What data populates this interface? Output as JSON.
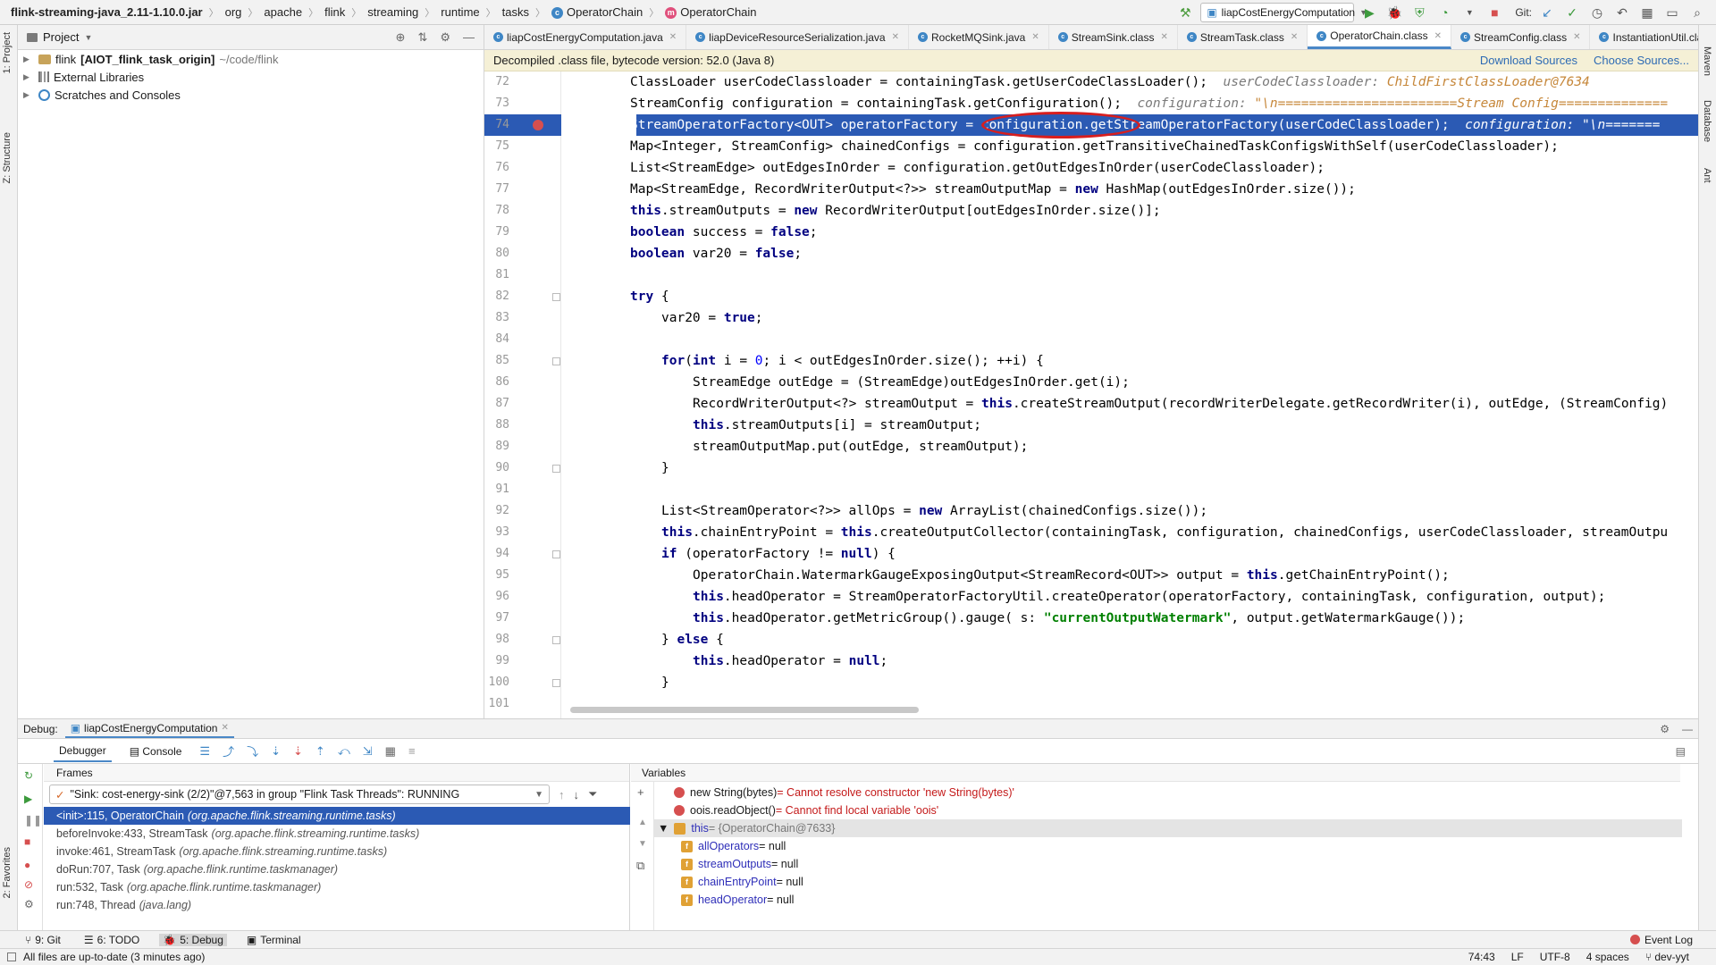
{
  "breadcrumbs": [
    "flink-streaming-java_2.11-1.10.0.jar",
    "org",
    "apache",
    "flink",
    "streaming",
    "runtime",
    "tasks",
    "OperatorChain",
    "OperatorChain"
  ],
  "run_config": "liapCostEnergyComputation",
  "git_label": "Git:",
  "left_strip": {
    "project": "1: Project",
    "structure": "Z: Structure",
    "favorites": "2: Favorites"
  },
  "right_strip": {
    "maven": "Maven",
    "database": "Database",
    "ant": "Ant"
  },
  "project_panel": {
    "title": "Project",
    "tree": [
      {
        "label": "flink",
        "bold_suffix": "[AIOT_flink_task_origin]",
        "path": "~/code/flink"
      },
      {
        "label": "External Libraries"
      },
      {
        "label": "Scratches and Consoles"
      }
    ]
  },
  "editor_tabs": [
    {
      "label": "liapCostEnergyComputation.java",
      "active": false
    },
    {
      "label": "liapDeviceResourceSerialization.java",
      "active": false
    },
    {
      "label": "RocketMQSink.java",
      "active": false
    },
    {
      "label": "StreamSink.class",
      "active": false
    },
    {
      "label": "StreamTask.class",
      "active": false
    },
    {
      "label": "OperatorChain.class",
      "active": true
    },
    {
      "label": "StreamConfig.class",
      "active": false
    },
    {
      "label": "InstantiationUtil.class",
      "active": false
    }
  ],
  "notice": {
    "text": "Decompiled .class file, bytecode version: 52.0 (Java 8)",
    "download_sources": "Download Sources",
    "choose_sources": "Choose Sources..."
  },
  "code_lines": [
    {
      "n": "72",
      "indent": 0,
      "text": "ClassLoader userCodeClassloader = containingTask.getUserCodeClassLoader();",
      "hint": "userCodeClassloader:",
      "hintval": "ChildFirstClassLoader@7634"
    },
    {
      "n": "73",
      "indent": 0,
      "text": "StreamConfig configuration = containingTask.getConfiguration();",
      "hint": "configuration:",
      "hintval": "\"\\n=======================Stream Config=============="
    },
    {
      "n": "74",
      "indent": 0,
      "text": "StreamOperatorFactory<OUT> operatorFactory = configuration.getStreamOperatorFactory(userCodeClassloader);",
      "hint": "configuration:",
      "hintval": "\"\\n=======",
      "selected": true,
      "breakpoint": true
    },
    {
      "n": "75",
      "indent": 0,
      "text": "Map<Integer, StreamConfig> chainedConfigs = configuration.getTransitiveChainedTaskConfigsWithSelf(userCodeClassloader);"
    },
    {
      "n": "76",
      "indent": 0,
      "text": "List<StreamEdge> outEdgesInOrder = configuration.getOutEdgesInOrder(userCodeClassloader);"
    },
    {
      "n": "77",
      "indent": 0,
      "text": "Map<StreamEdge, RecordWriterOutput<?>> streamOutputMap = new HashMap(outEdgesInOrder.size());"
    },
    {
      "n": "78",
      "indent": 0,
      "text": "this.streamOutputs = new RecordWriterOutput[outEdgesInOrder.size()];"
    },
    {
      "n": "79",
      "indent": 0,
      "text": "boolean success = false;"
    },
    {
      "n": "80",
      "indent": 0,
      "text": "boolean var20 = false;"
    },
    {
      "n": "81",
      "indent": 0,
      "text": ""
    },
    {
      "n": "82",
      "indent": 0,
      "text": "try {",
      "fold": true
    },
    {
      "n": "83",
      "indent": 1,
      "text": "var20 = true;"
    },
    {
      "n": "84",
      "indent": 0,
      "text": ""
    },
    {
      "n": "85",
      "indent": 1,
      "text": "for(int i = 0; i < outEdgesInOrder.size(); ++i) {",
      "fold": true
    },
    {
      "n": "86",
      "indent": 2,
      "text": "StreamEdge outEdge = (StreamEdge)outEdgesInOrder.get(i);"
    },
    {
      "n": "87",
      "indent": 2,
      "text": "RecordWriterOutput<?> streamOutput = this.createStreamOutput(recordWriterDelegate.getRecordWriter(i), outEdge, (StreamConfig)"
    },
    {
      "n": "88",
      "indent": 2,
      "text": "this.streamOutputs[i] = streamOutput;"
    },
    {
      "n": "89",
      "indent": 2,
      "text": "streamOutputMap.put(outEdge, streamOutput);"
    },
    {
      "n": "90",
      "indent": 1,
      "text": "}",
      "fold": true
    },
    {
      "n": "91",
      "indent": 0,
      "text": ""
    },
    {
      "n": "92",
      "indent": 1,
      "text": "List<StreamOperator<?>> allOps = new ArrayList(chainedConfigs.size());"
    },
    {
      "n": "93",
      "indent": 1,
      "text": "this.chainEntryPoint = this.createOutputCollector(containingTask, configuration, chainedConfigs, userCodeClassloader, streamOutpu"
    },
    {
      "n": "94",
      "indent": 1,
      "text": "if (operatorFactory != null) {",
      "fold": true
    },
    {
      "n": "95",
      "indent": 2,
      "text": "OperatorChain.WatermarkGaugeExposingOutput<StreamRecord<OUT>> output = this.getChainEntryPoint();"
    },
    {
      "n": "96",
      "indent": 2,
      "text": "this.headOperator = StreamOperatorFactoryUtil.createOperator(operatorFactory, containingTask, configuration, output);"
    },
    {
      "n": "97",
      "indent": 2,
      "text": "this.headOperator.getMetricGroup().gauge( s: \"currentOutputWatermark\", output.getWatermarkGauge());"
    },
    {
      "n": "98",
      "indent": 1,
      "text": "} else {",
      "fold": true
    },
    {
      "n": "99",
      "indent": 2,
      "text": "this.headOperator = null;"
    },
    {
      "n": "100",
      "indent": 1,
      "text": "}",
      "fold": true
    },
    {
      "n": "101",
      "indent": 0,
      "text": ""
    }
  ],
  "debug": {
    "label": "Debug:",
    "session": "liapCostEnergyComputation",
    "tabs": [
      "Debugger",
      "Console"
    ],
    "frames_title": "Frames",
    "variables_title": "Variables",
    "thread": "\"Sink: cost-energy-sink (2/2)\"@7,563 in group \"Flink Task Threads\": RUNNING",
    "frames": [
      {
        "method": "<init>:115, OperatorChain",
        "pkg": "(org.apache.flink.streaming.runtime.tasks)",
        "selected": true
      },
      {
        "method": "beforeInvoke:433, StreamTask",
        "pkg": "(org.apache.flink.streaming.runtime.tasks)"
      },
      {
        "method": "invoke:461, StreamTask",
        "pkg": "(org.apache.flink.streaming.runtime.tasks)"
      },
      {
        "method": "doRun:707, Task",
        "pkg": "(org.apache.flink.runtime.taskmanager)"
      },
      {
        "method": "run:532, Task",
        "pkg": "(org.apache.flink.runtime.taskmanager)"
      },
      {
        "method": "run:748, Thread",
        "pkg": "(java.lang)"
      }
    ],
    "variables": [
      {
        "kind": "error",
        "name": "new String(bytes)",
        "value": " = Cannot resolve constructor 'new String(bytes)'"
      },
      {
        "kind": "error",
        "name": "oois.readObject()",
        "value": " = Cannot find local variable 'oois'"
      },
      {
        "kind": "this",
        "name": "this",
        "value": " = {OperatorChain@7633}"
      },
      {
        "kind": "field",
        "name": "allOperators",
        "value": " = null"
      },
      {
        "kind": "field",
        "name": "streamOutputs",
        "value": " = null"
      },
      {
        "kind": "field",
        "name": "chainEntryPoint",
        "value": " = null"
      },
      {
        "kind": "field",
        "name": "headOperator",
        "value": " = null"
      }
    ]
  },
  "bottom_tools": [
    {
      "label": "9: Git",
      "active": false
    },
    {
      "label": "6: TODO",
      "active": false
    },
    {
      "label": "5: Debug",
      "active": true
    },
    {
      "label": "Terminal",
      "active": false
    }
  ],
  "event_log": "Event Log",
  "status": {
    "message": "All files are up-to-date (3 minutes ago)",
    "position": "74:43",
    "line_sep": "LF",
    "encoding": "UTF-8",
    "indent": "4 spaces",
    "branch": "dev-yyt"
  }
}
